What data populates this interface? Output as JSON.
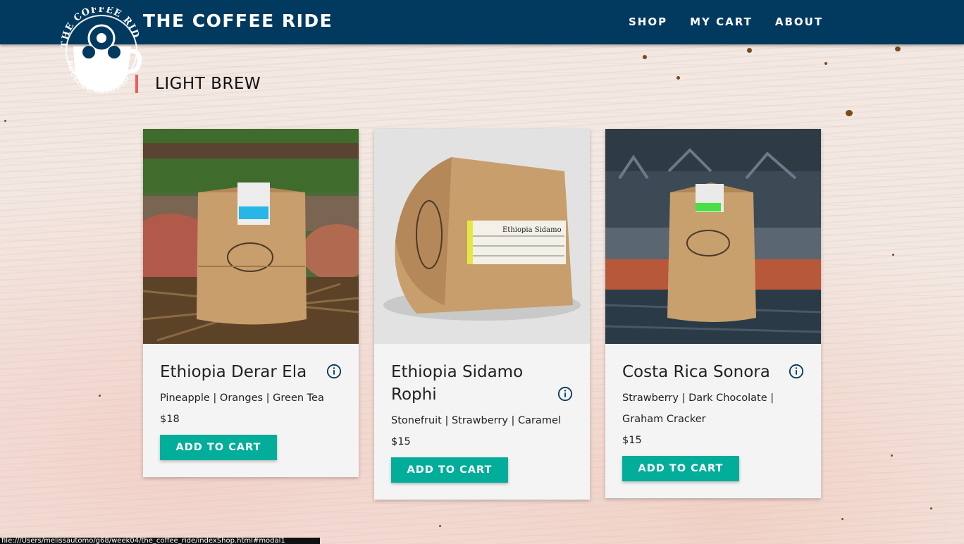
{
  "brand": {
    "title": "THE COFFEE RIDE",
    "logo_text": "THE COFFEE RIDE",
    "logo_subtext": "BOULDER COLORADO"
  },
  "nav": {
    "items": [
      {
        "label": "SHOP"
      },
      {
        "label": "MY CART"
      },
      {
        "label": "ABOUT"
      }
    ]
  },
  "section": {
    "title": "LIGHT BREW"
  },
  "products": [
    {
      "name": "Ethiopia Derar Ela",
      "notes": "Pineapple | Oranges | Green Tea",
      "price": "$18",
      "button": "ADD TO CART"
    },
    {
      "name": "Ethiopia Sidamo Rophi",
      "notes": "Stonefruit | Strawberry | Caramel",
      "price": "$15",
      "button": "ADD TO CART",
      "label_text": "Ethiopia Sidamo"
    },
    {
      "name": "Costa Rica Sonora",
      "notes": "Strawberry | Dark Chocolate | Graham Cracker",
      "price": "$15",
      "button": "ADD TO CART"
    }
  ],
  "status_bar": {
    "url": "file:///Users/melissautomo/g68/week04/the_coffee_ride/indexShop.html#modal1"
  },
  "colors": {
    "navbar": "#023a5f",
    "accent": "#ef5e5e",
    "button": "#02ad9a",
    "card": "#f4f4f4"
  }
}
